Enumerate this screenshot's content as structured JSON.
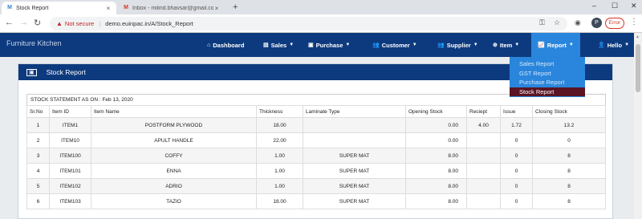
{
  "browser": {
    "tabs": [
      {
        "title": "Stock Report",
        "favicon": "M"
      },
      {
        "title": "Inbox - milind.bhavsar@gmail.com",
        "favicon": "M"
      }
    ],
    "url_warning": "Not secure",
    "url": "demo.euinpac.in/A/Stock_Report",
    "profile_badge": "Error"
  },
  "nav": {
    "brand": "Furniture Kitchen",
    "items": [
      {
        "label": "Dashboard",
        "icon": "dashboard-icon",
        "glyph": "⌂"
      },
      {
        "label": "Sales",
        "icon": "sales-icon",
        "glyph": "▤"
      },
      {
        "label": "Purchase",
        "icon": "purchase-icon",
        "glyph": "▣"
      },
      {
        "label": "Customer",
        "icon": "customer-icon",
        "glyph": "👥"
      },
      {
        "label": "Supplier",
        "icon": "supplier-icon",
        "glyph": "👥"
      },
      {
        "label": "Item",
        "icon": "item-icon",
        "glyph": "⊕"
      },
      {
        "label": "Report",
        "icon": "report-icon",
        "glyph": "📈"
      },
      {
        "label": "Hello",
        "icon": "user-icon",
        "glyph": "👤"
      }
    ]
  },
  "report_menu": {
    "items": [
      "Sales Report",
      "GST Report",
      "Purchase Report",
      "Stock Report"
    ],
    "active_index": 3
  },
  "panel": {
    "title": "Stock Report",
    "statement": "STOCK STATEMENT AS ON : Feb 13, 2020"
  },
  "table": {
    "columns": [
      "Sr.No",
      "Item ID",
      "Item Name",
      "Thickness",
      "Laminate Type",
      "Opening Stock",
      "Reciept",
      "Issue",
      "Closing Stock"
    ],
    "rows": [
      [
        "1",
        "ITEM1",
        "POSTFORM PLYWOOD",
        "18.00",
        "",
        "0.00",
        "4.00",
        "1.72",
        "13.2"
      ],
      [
        "2",
        "ITEM10",
        "APULT HANDLE",
        "22.00",
        "",
        "0.00",
        "",
        "0",
        "0"
      ],
      [
        "3",
        "ITEM100",
        "COFFY",
        "1.00",
        "SUPER MAT",
        "8.00",
        "",
        "0",
        "8"
      ],
      [
        "4",
        "ITEM101",
        "ENNA",
        "1.00",
        "SUPER MAT",
        "8.00",
        "",
        "0",
        "8"
      ],
      [
        "5",
        "ITEM102",
        "ADRIO",
        "1.00",
        "SUPER MAT",
        "8.00",
        "",
        "0",
        "8"
      ],
      [
        "6",
        "ITEM103",
        "TAZIO",
        "18.00",
        "SUPER MAT",
        "8.00",
        "",
        "0",
        "8"
      ]
    ]
  },
  "colors": {
    "navbar": "#0d3a7e",
    "active_nav": "#2a86dc",
    "active_menu_item": "#5a1424"
  }
}
